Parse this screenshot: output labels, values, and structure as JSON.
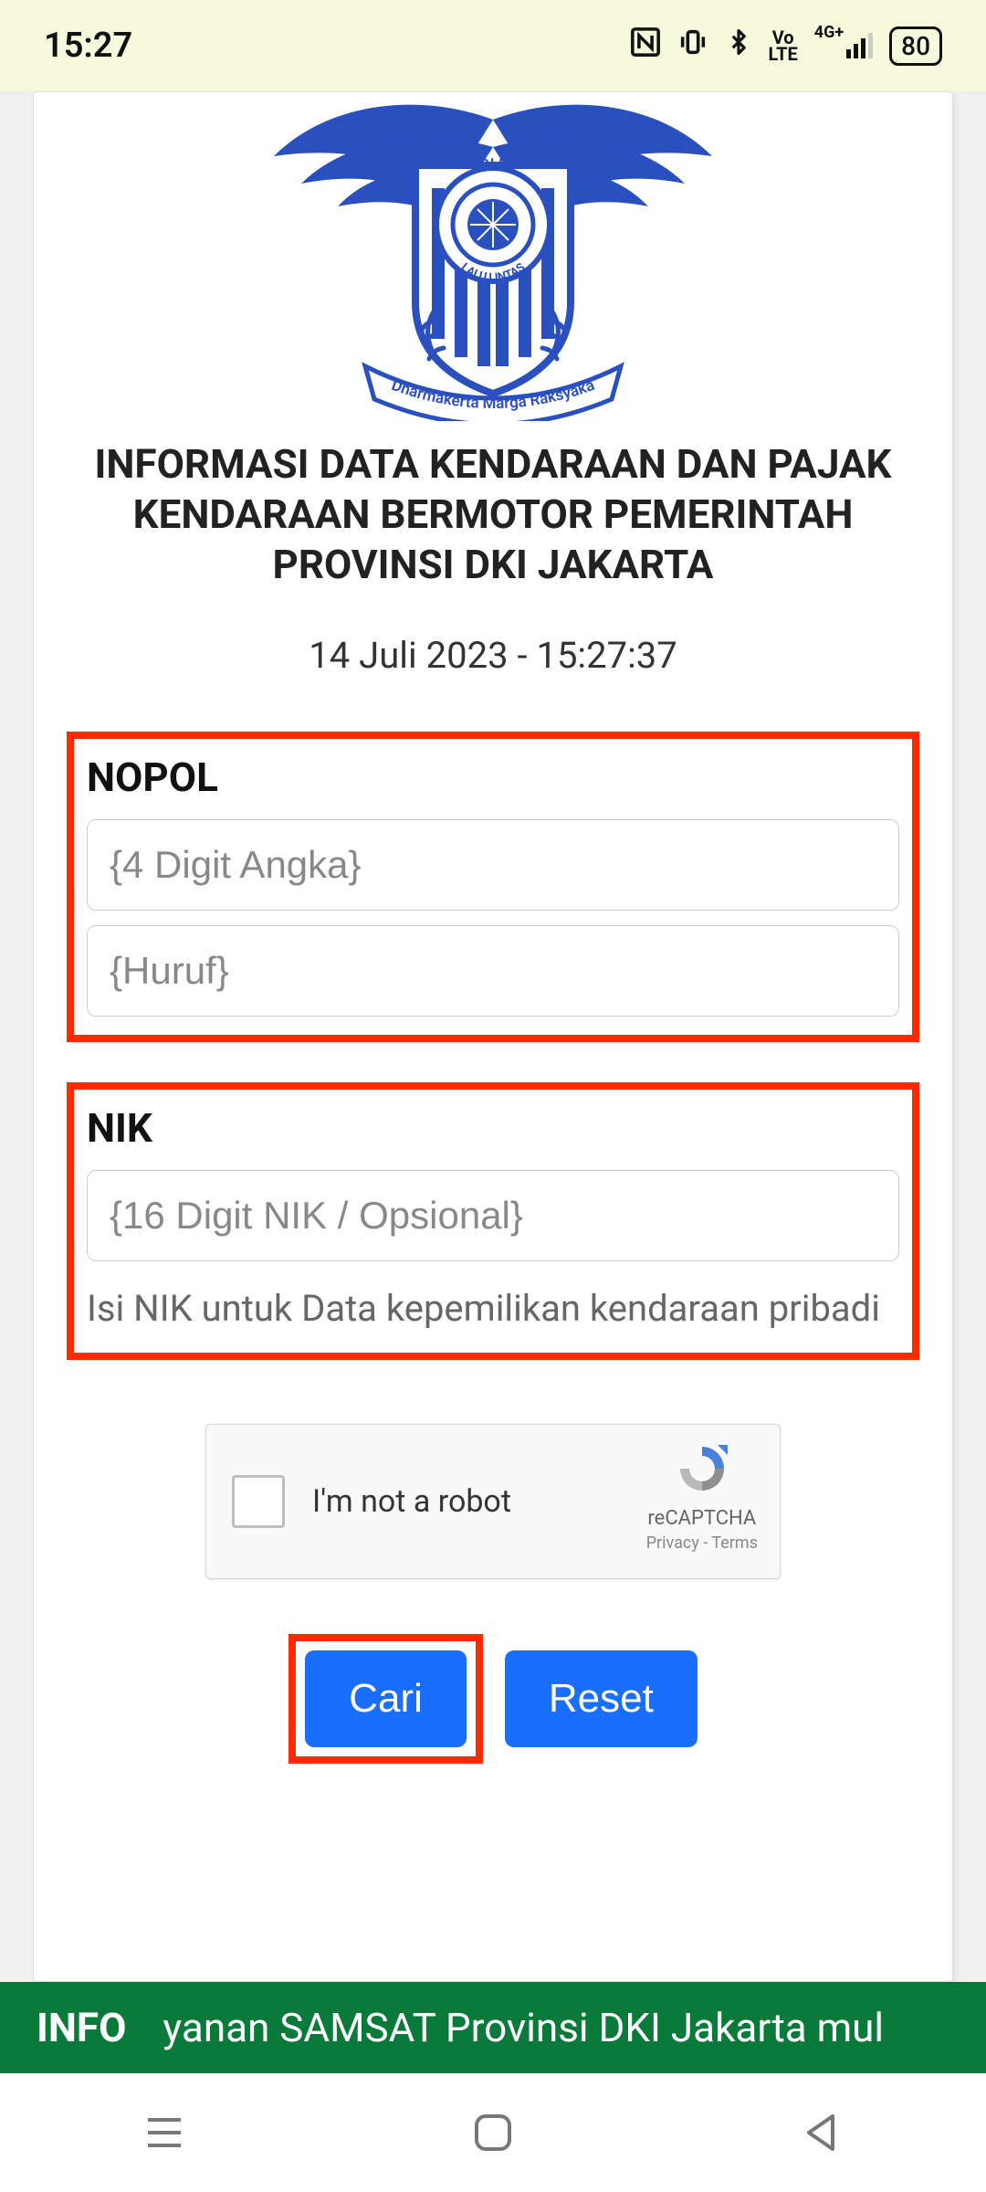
{
  "status": {
    "time": "15:27",
    "battery": "80",
    "network": "4G+",
    "volte": "Vo LTE"
  },
  "logo": {
    "text_top": "POLISI",
    "text_bottom": "LALU LINTAS",
    "ribbon": "Dharmakerta Marga Raksyaka"
  },
  "header": {
    "title": "INFORMASI DATA KENDARAAN DAN PAJAK KENDARAAN BERMOTOR PEMERINTAH PROVINSI DKI JAKARTA",
    "datetime": "14 Juli 2023 - 15:27:37"
  },
  "form": {
    "nopol_label": "NOPOL",
    "nopol_digits_placeholder": "{4 Digit Angka}",
    "nopol_letters_placeholder": "{Huruf}",
    "nik_label": "NIK",
    "nik_placeholder": "{16 Digit NIK / Opsional}",
    "nik_helper": "Isi NIK untuk Data kepemilikan kendaraan pribadi"
  },
  "recaptcha": {
    "label": "I'm not a robot",
    "brand": "reCAPTCHA",
    "links": "Privacy - Terms"
  },
  "buttons": {
    "cari": "Cari",
    "reset": "Reset"
  },
  "banner": {
    "label": "INFO",
    "scroll": "yanan SAMSAT Provinsi DKI Jakarta mul"
  }
}
